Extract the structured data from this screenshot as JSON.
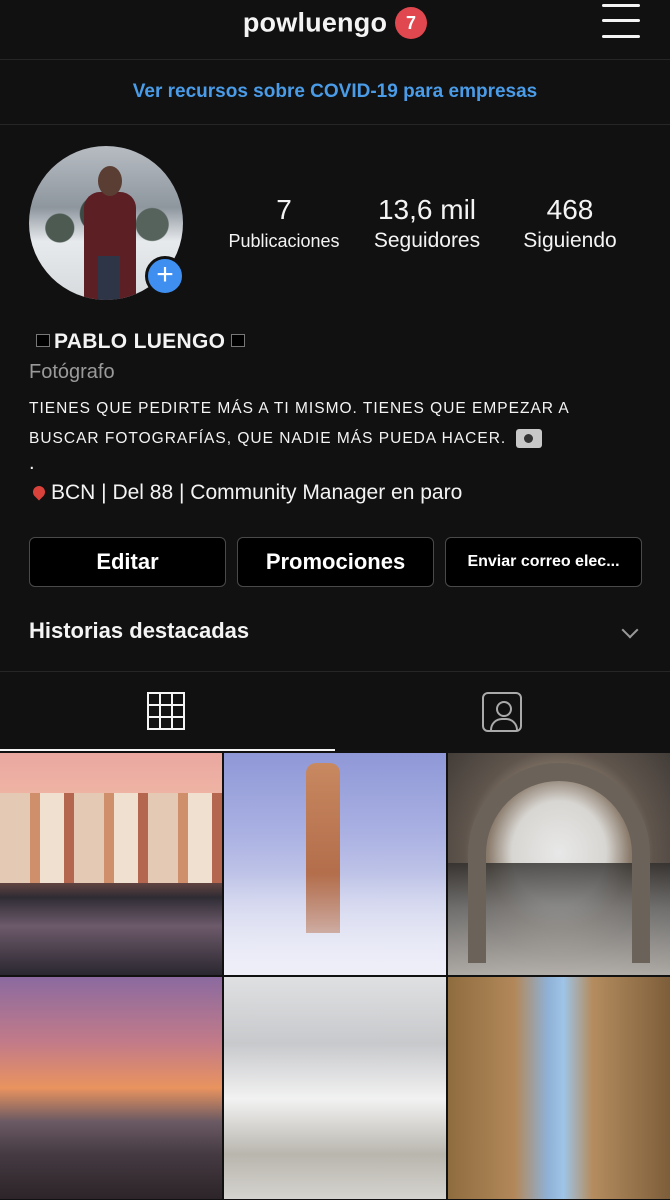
{
  "header": {
    "username": "powluengo",
    "notification_count": "7",
    "menu_icon": "hamburger-menu-icon"
  },
  "banner": {
    "text": "Ver recursos sobre COVID-19 para empresas",
    "color": "#4a9ce8"
  },
  "profile": {
    "stats": [
      {
        "value": "7",
        "label": "Publicaciones"
      },
      {
        "value": "13,6 mil",
        "label": "Seguidores"
      },
      {
        "value": "468",
        "label": "Siguiendo"
      }
    ],
    "full_name": "PABLO LUENGO",
    "category": "Fotógrafo",
    "bio_line1": "TIENES QUE PEDIRTE MÁS A TI MISMO. TIENES QUE EMPEZAR A",
    "bio_line2": "BUSCAR FOTOGRAFÍAS, QUE NADIE MÁS PUEDA HACER.",
    "bio_dot": ".",
    "location_line": "BCN | Del 88 | Community Manager en paro"
  },
  "actions": {
    "edit_label": "Editar",
    "promotions_label": "Promociones",
    "email_label": "Enviar correo elec..."
  },
  "highlights": {
    "title": "Historias destacadas"
  },
  "tabs": [
    {
      "icon": "grid-icon",
      "active": true
    },
    {
      "icon": "tagged-user-icon",
      "active": false
    }
  ],
  "posts": [
    {
      "name": "post-canal-village"
    },
    {
      "name": "post-tower-fountain"
    },
    {
      "name": "post-bridge-arch-reflection"
    },
    {
      "name": "post-sunset-lake"
    },
    {
      "name": "post-white-village"
    },
    {
      "name": "post-street-reflection"
    }
  ]
}
